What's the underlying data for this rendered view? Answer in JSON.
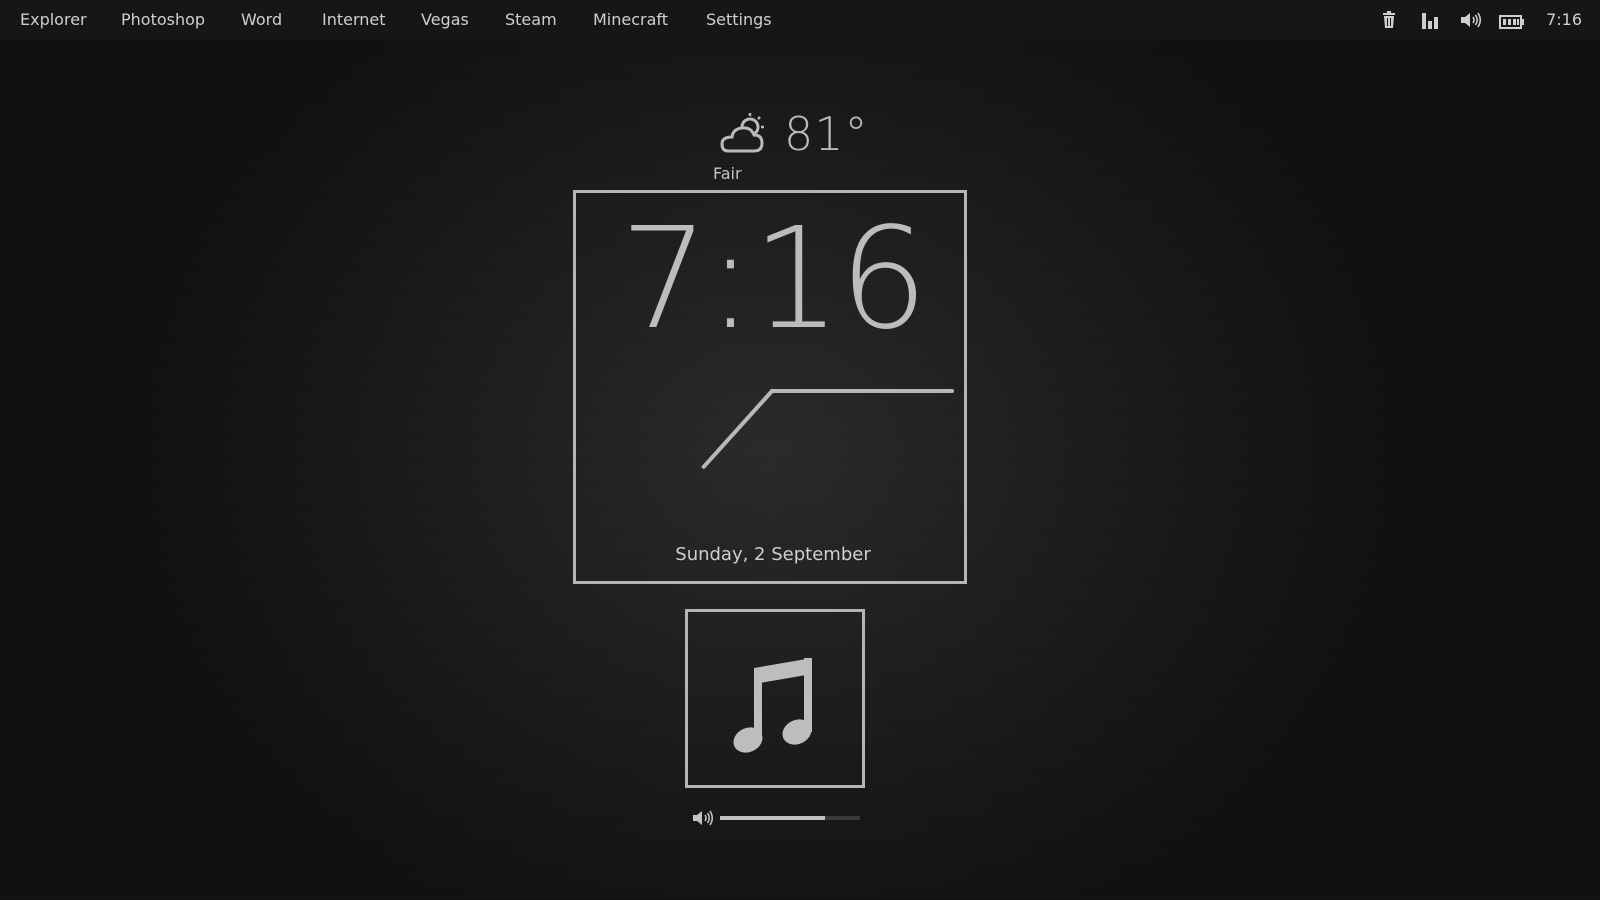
{
  "menu": {
    "items": [
      {
        "label": "Explorer"
      },
      {
        "label": "Photoshop"
      },
      {
        "label": "Word"
      },
      {
        "label": "Internet"
      },
      {
        "label": "Vegas"
      },
      {
        "label": "Steam"
      },
      {
        "label": "Minecraft"
      },
      {
        "label": "Settings"
      }
    ]
  },
  "tray": {
    "icons": [
      "trash-icon",
      "signal-bars-icon",
      "speaker-icon",
      "battery-icon"
    ],
    "time": "7:16"
  },
  "weather": {
    "icon": "cloud-sun-icon",
    "temperature": "81°",
    "condition": "Fair"
  },
  "clock": {
    "time": "7:16",
    "date": "Sunday, 2 September",
    "hour": 7,
    "minute": 16
  },
  "music": {
    "icon": "music-note-icon",
    "volume_icon": "speaker-icon",
    "volume": 0.75
  },
  "colors": {
    "foreground": "#c8c8c8",
    "frame": "#b5b5b5",
    "background": "#141414"
  }
}
